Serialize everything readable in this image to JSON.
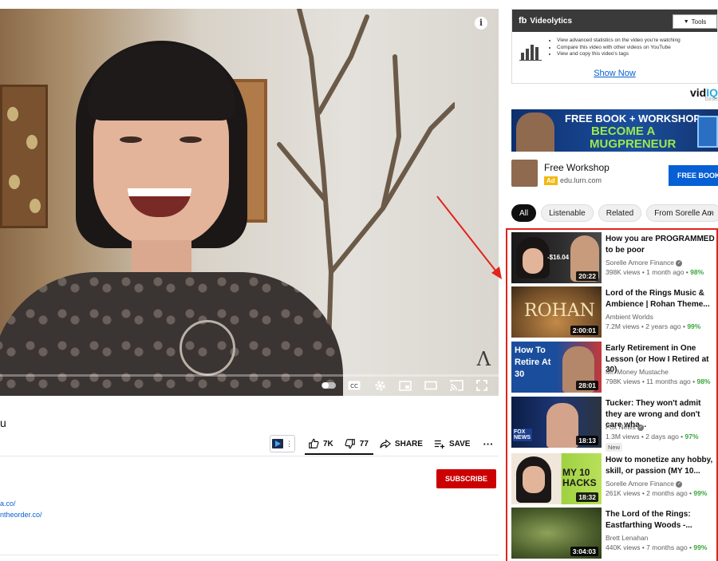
{
  "player": {
    "controls": [
      "autoplay-toggle",
      "cc-icon",
      "gear-icon",
      "miniplayer-icon",
      "theater-icon",
      "cast-icon",
      "fullscreen-icon"
    ]
  },
  "video": {
    "title_fragment": "u",
    "likes": "7K",
    "dislikes": "77",
    "share_label": "SHARE",
    "save_label": "SAVE",
    "subscribe_label": "SUBSCRIBE",
    "desc_links": [
      "a.co/",
      "ntheorder.co/"
    ]
  },
  "videolytics": {
    "brand": "Videolytics",
    "tools_label": "Tools",
    "features": [
      "View advanced statistics on the video you're watching",
      "Compare this video with other videos on YouTube",
      "View and copy this video's tags"
    ],
    "show_now": "Show Now"
  },
  "vidiq": {
    "brand_a": "vid",
    "brand_b": "IQ",
    "tier": "basic"
  },
  "ad_banner": {
    "line1": "FREE BOOK + WORKSHOP:",
    "line2": "BECOME A",
    "line3": "MUGPRENEUR"
  },
  "ad": {
    "title": "Free Workshop",
    "badge": "Ad",
    "domain": "edu.lurn.com",
    "cta": "FREE BOOK"
  },
  "chips": [
    "All",
    "Listenable",
    "Related",
    "From Sorelle Am"
  ],
  "recommendations": [
    {
      "title": "How you are PROGRAMMED to be poor",
      "channel": "Sorelle Amore Finance",
      "verified": true,
      "meta": "398K views • 1 month ago • ",
      "pct": "98%",
      "duration": "20:22",
      "thumb_text": "-$16.04"
    },
    {
      "title": "Lord of the Rings Music & Ambience | Rohan Theme...",
      "channel": "Ambient Worlds",
      "verified": false,
      "meta": "7.2M views • 2 years ago • ",
      "pct": "99%",
      "duration": "2:00:01",
      "thumb_text": "ROHAN"
    },
    {
      "title": "Early Retirement in One Lesson (or How I Retired at 30)",
      "channel": "Mr. Money Mustache",
      "verified": false,
      "meta": "798K views • 11 months ago • ",
      "pct": "98%",
      "duration": "28:01",
      "thumb_text": "How To Retire At 30"
    },
    {
      "title": "Tucker: They won't admit they are wrong and don't care wha...",
      "channel": "Fox News",
      "verified": true,
      "meta": "1.3M views • 2 days ago • ",
      "pct": "97%",
      "duration": "18:13",
      "thumb_text": "FOX NEWS",
      "new_badge": "New"
    },
    {
      "title": "How to monetize any hobby, skill, or passion (MY 10...",
      "channel": "Sorelle Amore Finance",
      "verified": true,
      "meta": "261K views • 2 months ago • ",
      "pct": "99%",
      "duration": "18:32",
      "thumb_text": "MY 10 HACKS"
    },
    {
      "title": "The Lord of the Rings: Eastfarthing Woods -...",
      "channel": "Brett Lenahan",
      "verified": false,
      "meta": "440K views • 7 months ago • ",
      "pct": "99%",
      "duration": "3:04:03",
      "thumb_text": ""
    }
  ],
  "colors": {
    "accent_red": "#e0241c",
    "subscribe": "#cc0000",
    "link": "#065fd4",
    "pct_green": "#3aa63a"
  }
}
